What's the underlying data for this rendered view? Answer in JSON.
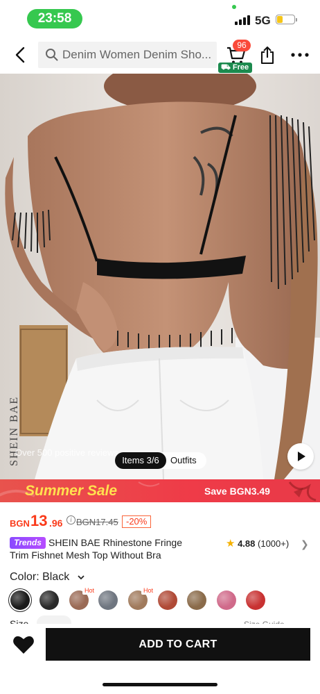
{
  "status_bar": {
    "time": "23:58",
    "network": "5G"
  },
  "nav": {
    "search_placeholder": "Denim Women Denim Sho...",
    "cart_count": "96",
    "free_label": "Free"
  },
  "hero": {
    "brand_watermark": "SHEIN BAE",
    "reviews_watermark": "Over 500 positive reviews",
    "items_counter": "Items 3/6",
    "outfits_label": "Outfits"
  },
  "promo": {
    "title": "Summer Sale",
    "save_text": "Save BGN3.49",
    "colors": {
      "bg": "#ef3b48",
      "title": "#ffe14f"
    }
  },
  "price": {
    "currency": "BGN",
    "integer": "13",
    "decimal": ".96",
    "original": "BGN17.45",
    "discount": "-20%",
    "color": "#fa3a1a"
  },
  "product": {
    "tag": "Trends",
    "title_line1": "SHEIN BAE Rhinestone Fringe",
    "title_line2": "Trim Fishnet Mesh Top Without Bra",
    "rating": "4.88",
    "review_count": "(1000+)"
  },
  "color_select": {
    "label": "Color: Black",
    "hot_label": "Hot",
    "swatches": [
      {
        "name": "black",
        "color": "#1a1a1a",
        "selected": true,
        "hot": false
      },
      {
        "name": "black-mesh",
        "color": "#2a2a2a",
        "selected": false,
        "hot": false
      },
      {
        "name": "brown-mesh",
        "color": "#9a6a55",
        "selected": false,
        "hot": true
      },
      {
        "name": "silver-mesh",
        "color": "#6f7680",
        "selected": false,
        "hot": false
      },
      {
        "name": "tan-mesh",
        "color": "#a07a5c",
        "selected": false,
        "hot": true
      },
      {
        "name": "red-brown",
        "color": "#b04a36",
        "selected": false,
        "hot": false
      },
      {
        "name": "gold-mesh",
        "color": "#8a6b4a",
        "selected": false,
        "hot": false
      },
      {
        "name": "pink-mesh",
        "color": "#d06a8a",
        "selected": false,
        "hot": false
      },
      {
        "name": "red-mesh",
        "color": "#c83232",
        "selected": false,
        "hot": false
      }
    ]
  },
  "size": {
    "label": "Size",
    "guide": "Size Guide"
  },
  "bottom_bar": {
    "add_to_cart": "ADD TO CART"
  }
}
